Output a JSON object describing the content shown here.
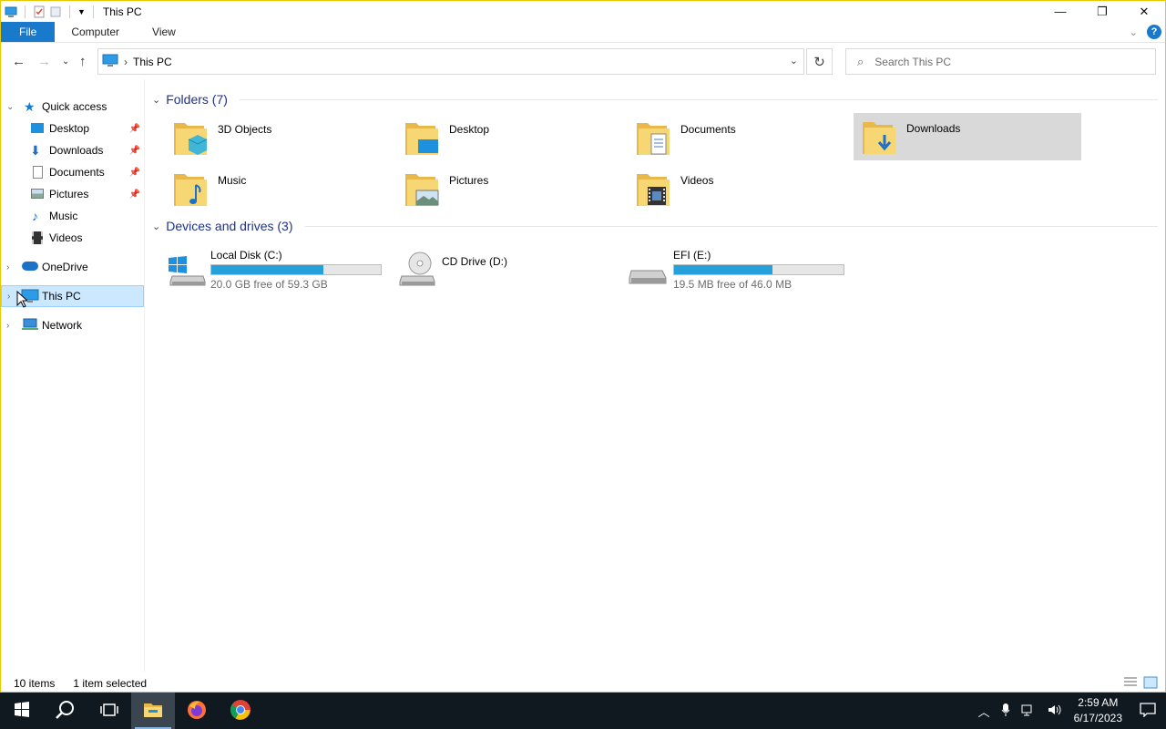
{
  "window": {
    "title": "This PC",
    "controls": {
      "minimize": "—",
      "maximize": "❐",
      "close": "✕"
    }
  },
  "ribbon": {
    "tabs": [
      "File",
      "Computer",
      "View"
    ],
    "help": "?"
  },
  "address": {
    "path": "This PC",
    "search_placeholder": "Search This PC"
  },
  "navpane": {
    "quick_access": "Quick access",
    "quick_items": [
      "Desktop",
      "Downloads",
      "Documents",
      "Pictures",
      "Music",
      "Videos"
    ],
    "onedrive": "OneDrive",
    "this_pc": "This PC",
    "network": "Network"
  },
  "content": {
    "folders_header": "Folders (7)",
    "folders": [
      "3D Objects",
      "Desktop",
      "Documents",
      "Downloads",
      "Music",
      "Pictures",
      "Videos"
    ],
    "selected_folder": "Downloads",
    "devices_header": "Devices and drives (3)",
    "drives": [
      {
        "name": "Local Disk (C:)",
        "free": "20.0 GB free of 59.3 GB",
        "used_fraction": 0.66
      },
      {
        "name": "CD Drive (D:)"
      },
      {
        "name": "EFI (E:)",
        "free": "19.5 MB free of 46.0 MB",
        "used_fraction": 0.58
      }
    ]
  },
  "status": {
    "items": "10 items",
    "selected": "1 item selected"
  },
  "taskbar": {
    "time": "2:59 AM",
    "date": "6/17/2023"
  },
  "colors": {
    "accent": "#1979ca",
    "selection": "#cce8ff",
    "drive_bar": "#26a0da",
    "taskbar": "#101820"
  }
}
